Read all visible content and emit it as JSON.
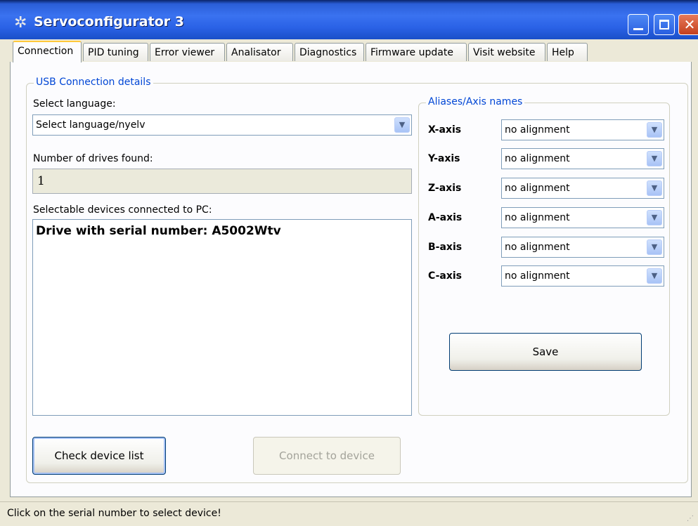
{
  "window": {
    "title": "Servoconfigurator 3"
  },
  "tabs": [
    {
      "label": "Connection",
      "active": true
    },
    {
      "label": "PID tuning"
    },
    {
      "label": "Error viewer"
    },
    {
      "label": "Analisator"
    },
    {
      "label": "Diagnostics"
    },
    {
      "label": "Firmware update"
    },
    {
      "label": "Visit website"
    },
    {
      "label": "Help"
    }
  ],
  "usb": {
    "legend": "USB Connection details",
    "language_label": "Select language:",
    "language_value": "Select language/nyelv",
    "drives_label": "Number of drives found:",
    "drives_value": "1",
    "devices_label": "Selectable devices connected to PC:",
    "devices": [
      "Drive with serial number: A5002Wtv"
    ],
    "check_button": "Check device list",
    "connect_button": "Connect to device"
  },
  "aliases": {
    "legend": "Aliases/Axis names",
    "axes": [
      {
        "name": "X-axis",
        "value": "no alignment"
      },
      {
        "name": "Y-axis",
        "value": "no alignment"
      },
      {
        "name": "Z-axis",
        "value": "no alignment"
      },
      {
        "name": "A-axis",
        "value": "no alignment"
      },
      {
        "name": "B-axis",
        "value": "no alignment"
      },
      {
        "name": "C-axis",
        "value": "no alignment"
      }
    ],
    "save_button": "Save"
  },
  "status": {
    "text": "Click on the serial number to select device!"
  },
  "icons": {
    "dropdown": "▼",
    "close": "✕",
    "app": "✲"
  }
}
